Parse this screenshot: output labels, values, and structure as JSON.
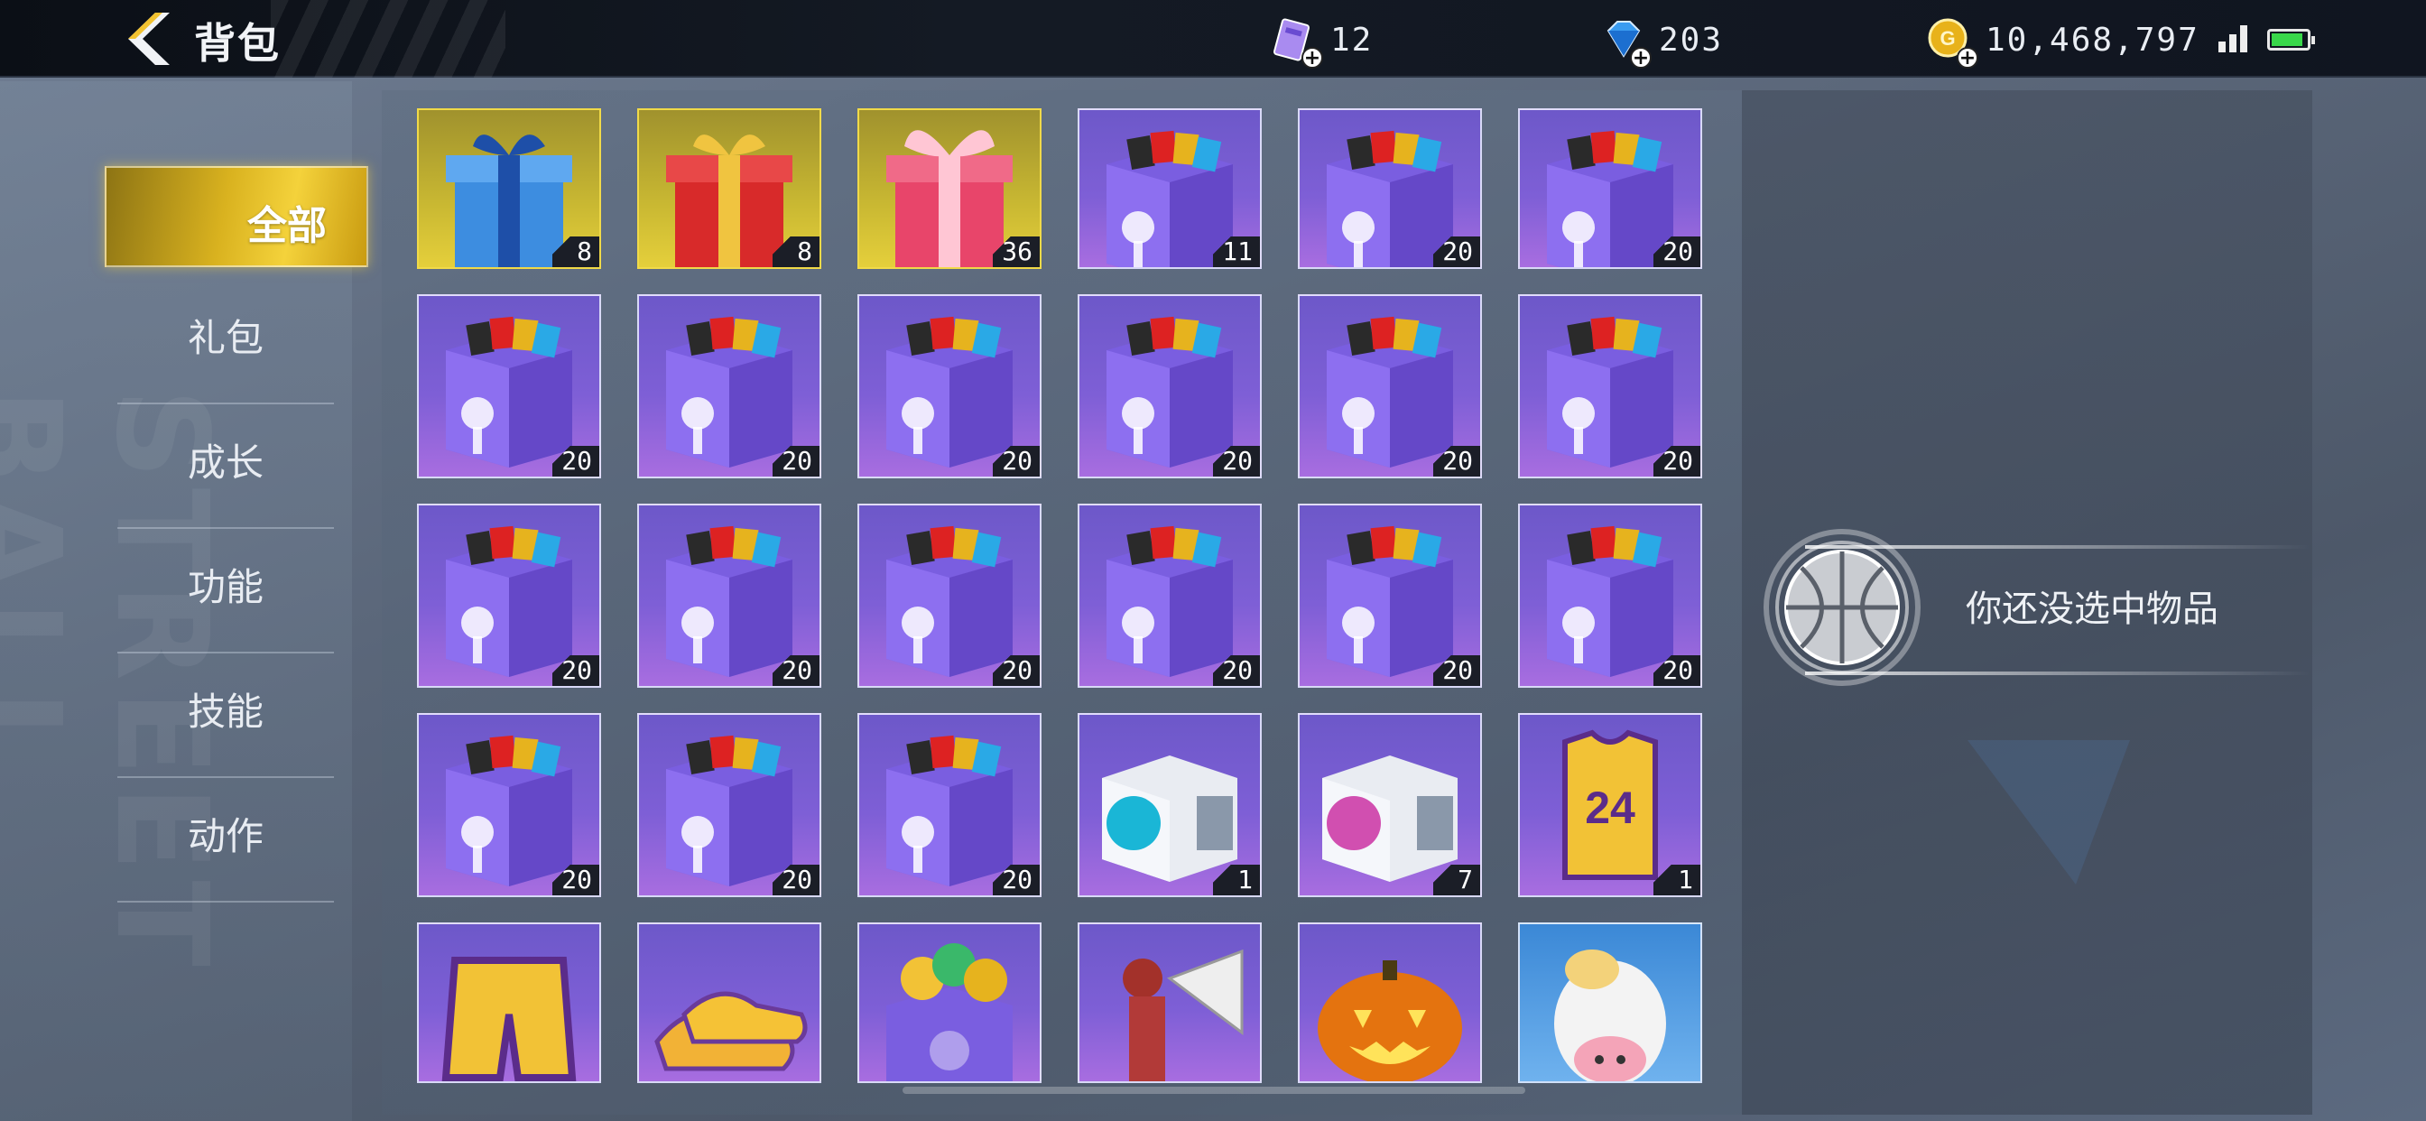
{
  "header": {
    "title": "背包",
    "resources": [
      {
        "name": "tickets",
        "icon": "ticket-icon",
        "value": "12"
      },
      {
        "name": "diamonds",
        "icon": "diamond-icon",
        "value": "203"
      },
      {
        "name": "coins",
        "icon": "gold-coin-icon",
        "value": "10,468,797"
      }
    ]
  },
  "sidebar": {
    "watermark": "STREET BALL",
    "tabs": [
      {
        "label": "全部",
        "active": true
      },
      {
        "label": "礼包",
        "active": false
      },
      {
        "label": "成长",
        "active": false
      },
      {
        "label": "功能",
        "active": false
      },
      {
        "label": "技能",
        "active": false
      },
      {
        "label": "动作",
        "active": false
      }
    ]
  },
  "inventory": {
    "items": [
      {
        "kind": "gift-blue",
        "rarity": "gold",
        "count": "8"
      },
      {
        "kind": "gift-red",
        "rarity": "gold",
        "count": "8"
      },
      {
        "kind": "gift-pink",
        "rarity": "gold",
        "count": "36"
      },
      {
        "kind": "card-box",
        "rarity": "purple",
        "count": "11"
      },
      {
        "kind": "card-box",
        "rarity": "purple",
        "count": "20"
      },
      {
        "kind": "card-box",
        "rarity": "purple",
        "count": "20"
      },
      {
        "kind": "card-box",
        "rarity": "purple",
        "count": "20"
      },
      {
        "kind": "card-box",
        "rarity": "purple",
        "count": "20"
      },
      {
        "kind": "card-box",
        "rarity": "purple",
        "count": "20"
      },
      {
        "kind": "card-box",
        "rarity": "purple",
        "count": "20"
      },
      {
        "kind": "card-box",
        "rarity": "purple",
        "count": "20"
      },
      {
        "kind": "card-box",
        "rarity": "purple",
        "count": "20"
      },
      {
        "kind": "card-box",
        "rarity": "purple",
        "count": "20"
      },
      {
        "kind": "card-box",
        "rarity": "purple",
        "count": "20"
      },
      {
        "kind": "card-box",
        "rarity": "purple",
        "count": "20"
      },
      {
        "kind": "card-box",
        "rarity": "purple",
        "count": "20"
      },
      {
        "kind": "card-box",
        "rarity": "purple",
        "count": "20"
      },
      {
        "kind": "card-box",
        "rarity": "purple",
        "count": "20"
      },
      {
        "kind": "card-box",
        "rarity": "purple",
        "count": "20"
      },
      {
        "kind": "card-box",
        "rarity": "purple",
        "count": "20"
      },
      {
        "kind": "card-box",
        "rarity": "purple",
        "count": "20"
      },
      {
        "kind": "white-box-cyan",
        "rarity": "purple",
        "count": "1"
      },
      {
        "kind": "white-box-pink",
        "rarity": "purple",
        "count": "7"
      },
      {
        "kind": "jersey-24",
        "rarity": "purple",
        "count": "1"
      },
      {
        "kind": "shorts",
        "rarity": "purple",
        "count": ""
      },
      {
        "kind": "sneakers",
        "rarity": "purple",
        "count": ""
      },
      {
        "kind": "badge-box",
        "rarity": "purple",
        "count": ""
      },
      {
        "kind": "turkey-fan",
        "rarity": "purple",
        "count": ""
      },
      {
        "kind": "pumpkin",
        "rarity": "purple",
        "count": ""
      },
      {
        "kind": "cow-head",
        "rarity": "skyblue",
        "count": ""
      }
    ]
  },
  "detail": {
    "empty_text": "你还没选中物品",
    "icon": "basketball-icon"
  },
  "colors": {
    "gold_accent": "#f4d23b",
    "purple_slot": "#7e5fd6",
    "topbar": "#0b0f16"
  }
}
